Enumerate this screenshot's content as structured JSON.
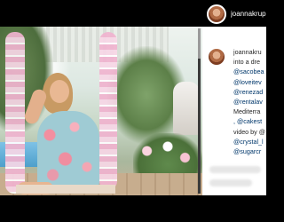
{
  "post": {
    "username": "joannakrupa",
    "username_truncated": "joannakrup",
    "caption_lines": [
      {
        "text": "joannakru",
        "type": "username"
      },
      {
        "text": "into a dre",
        "type": "text"
      },
      {
        "text": "@sacobea",
        "type": "mention"
      },
      {
        "text": "@loveitev",
        "type": "mention"
      },
      {
        "text": "@renezad",
        "type": "mention"
      },
      {
        "text": "@rentalav",
        "type": "mention"
      },
      {
        "text": "Mediterra",
        "type": "text"
      },
      {
        "text": ", @cakest",
        "type": "mention"
      },
      {
        "text": "video by @",
        "type": "text"
      },
      {
        "text": "@crystal_l",
        "type": "mention"
      },
      {
        "text": "@sugarcr",
        "type": "mention"
      }
    ]
  },
  "media": {
    "type": "photo",
    "alt_semantic": "woman in floral dress on pink swing"
  },
  "colors": {
    "text": "#262626",
    "mention": "#00376b",
    "background_panel": "#ffffff",
    "dress_base": "#9fcbd4",
    "swing_pink": "#f0b3cf"
  }
}
